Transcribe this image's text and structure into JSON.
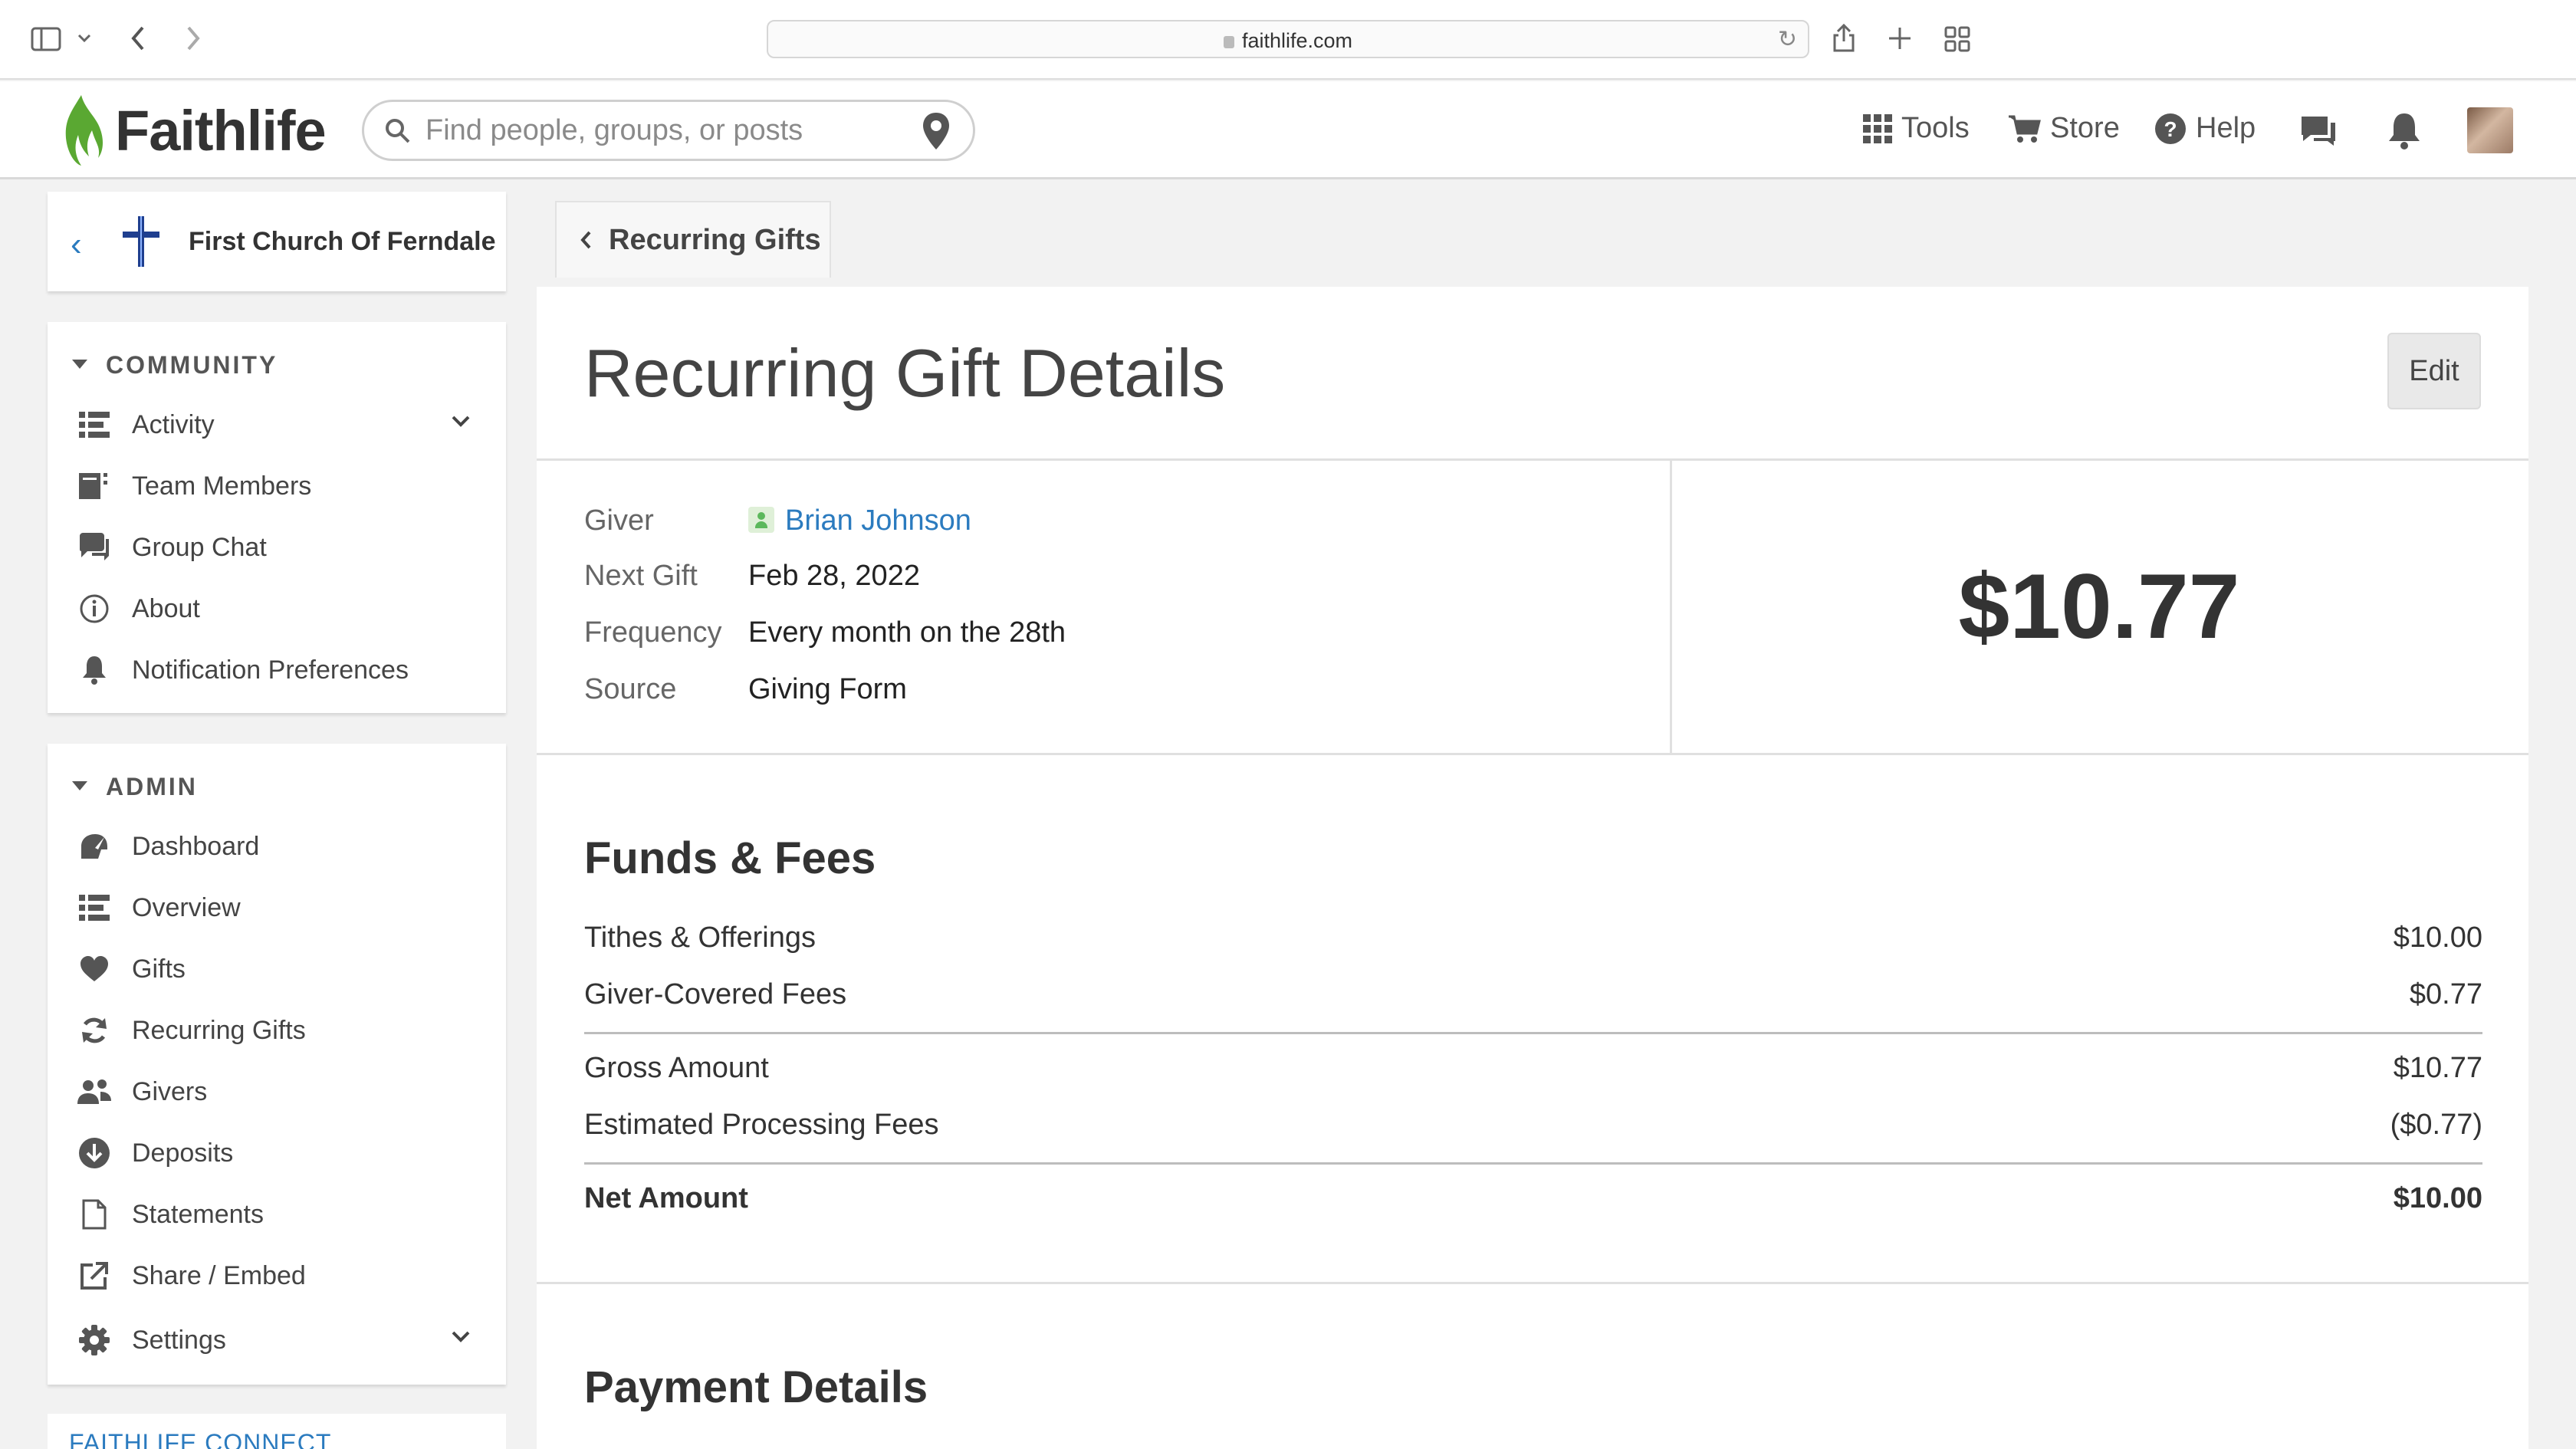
{
  "browser": {
    "url": "faithlife.com"
  },
  "header": {
    "logo_text": "Faithlife",
    "search_placeholder": "Find people, groups, or posts",
    "nav": {
      "tools": "Tools",
      "store": "Store",
      "help": "Help"
    }
  },
  "sidebar": {
    "church_name": "First Church Of Ferndale",
    "community": {
      "heading": "COMMUNITY",
      "items": [
        {
          "label": "Activity",
          "icon": "list-icon"
        },
        {
          "label": "Team Members",
          "icon": "team-icon"
        },
        {
          "label": "Group Chat",
          "icon": "chat-icon"
        },
        {
          "label": "About",
          "icon": "info-icon"
        },
        {
          "label": "Notification Preferences",
          "icon": "bell-icon"
        }
      ]
    },
    "admin": {
      "heading": "ADMIN",
      "items": [
        {
          "label": "Dashboard",
          "icon": "dashboard-icon"
        },
        {
          "label": "Overview",
          "icon": "list-icon"
        },
        {
          "label": "Gifts",
          "icon": "heart-icon"
        },
        {
          "label": "Recurring Gifts",
          "icon": "recurring-icon"
        },
        {
          "label": "Givers",
          "icon": "people-icon"
        },
        {
          "label": "Deposits",
          "icon": "deposit-icon"
        },
        {
          "label": "Statements",
          "icon": "document-icon"
        },
        {
          "label": "Share / Embed",
          "icon": "share-icon"
        },
        {
          "label": "Settings",
          "icon": "gear-icon"
        }
      ]
    },
    "connect_heading": "FAITHLIFE CONNECT"
  },
  "main": {
    "breadcrumb": "Recurring Gifts",
    "title": "Recurring Gift Details",
    "edit_label": "Edit",
    "details": [
      {
        "label": "Giver",
        "value": "Brian Johnson"
      },
      {
        "label": "Next Gift",
        "value": "Feb 28, 2022"
      },
      {
        "label": "Frequency",
        "value": "Every month on the 28th"
      },
      {
        "label": "Source",
        "value": "Giving Form"
      }
    ],
    "amount": "$10.77",
    "funds_title": "Funds & Fees",
    "funds": [
      {
        "label": "Tithes & Offerings",
        "amount": "$10.00"
      },
      {
        "label": "Giver-Covered Fees",
        "amount": "$0.77"
      },
      {
        "label": "Gross Amount",
        "amount": "$10.77"
      },
      {
        "label": "Estimated Processing Fees",
        "amount": "($0.77)"
      },
      {
        "label": "Net Amount",
        "amount": "$10.00"
      }
    ],
    "payment_title": "Payment Details"
  },
  "colors": {
    "link": "#2b7bbf",
    "brand_green": "#5aa832"
  }
}
